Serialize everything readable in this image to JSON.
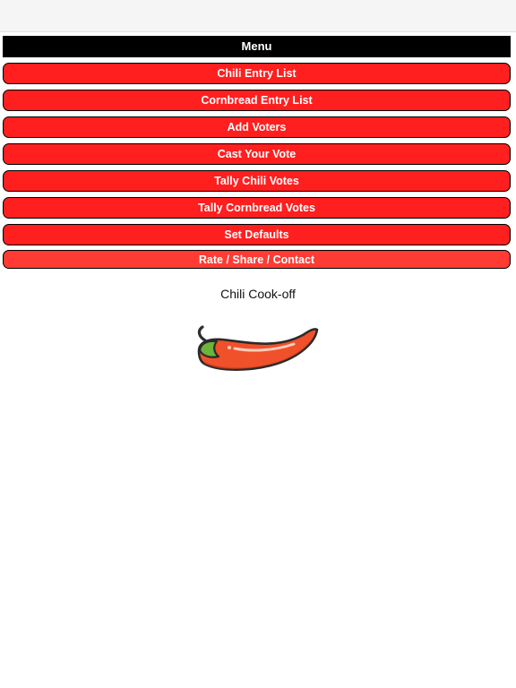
{
  "menu": {
    "header": "Menu",
    "items": [
      {
        "label": "Chili Entry List"
      },
      {
        "label": "Cornbread Entry List"
      },
      {
        "label": "Add Voters"
      },
      {
        "label": "Cast Your Vote"
      },
      {
        "label": "Tally Chili Votes"
      },
      {
        "label": "Tally Cornbread Votes"
      },
      {
        "label": "Set Defaults"
      },
      {
        "label": "Rate / Share / Contact"
      }
    ]
  },
  "main": {
    "title": "Chili Cook-off",
    "logo_icon": "chili-pepper-icon"
  },
  "colors": {
    "button_red": "#ff1f1f",
    "header_black": "#000000"
  }
}
